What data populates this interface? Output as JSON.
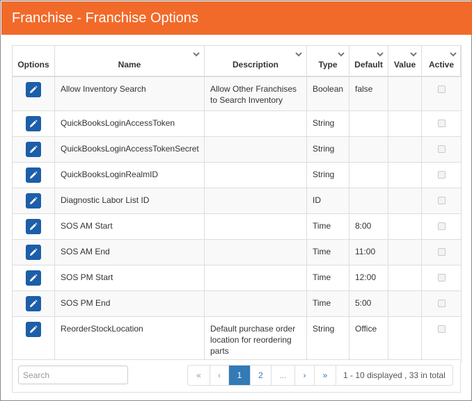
{
  "header": {
    "title": "Franchise - Franchise Options",
    "bg_color": "#f26a2a"
  },
  "table": {
    "columns": [
      {
        "key": "options",
        "label": "Options",
        "sortable": false
      },
      {
        "key": "name",
        "label": "Name",
        "sortable": true
      },
      {
        "key": "description",
        "label": "Description",
        "sortable": true
      },
      {
        "key": "type",
        "label": "Type",
        "sortable": true
      },
      {
        "key": "default",
        "label": "Default",
        "sortable": true
      },
      {
        "key": "value",
        "label": "Value",
        "sortable": true
      },
      {
        "key": "active",
        "label": "Active",
        "sortable": true
      }
    ],
    "rows": [
      {
        "name": "Allow Inventory Search",
        "description": "Allow Other Franchises to Search Inventory",
        "type": "Boolean",
        "default": "false",
        "value": "",
        "active": false
      },
      {
        "name": "QuickBooksLoginAccessToken",
        "description": "",
        "type": "String",
        "default": "",
        "value": "",
        "active": false
      },
      {
        "name": "QuickBooksLoginAccessTokenSecret",
        "description": "",
        "type": "String",
        "default": "",
        "value": "",
        "active": false
      },
      {
        "name": "QuickBooksLoginRealmID",
        "description": "",
        "type": "String",
        "default": "",
        "value": "",
        "active": false
      },
      {
        "name": "Diagnostic Labor List ID",
        "description": "",
        "type": "ID",
        "default": "",
        "value": "",
        "active": false
      },
      {
        "name": "SOS AM Start",
        "description": "",
        "type": "Time",
        "default": "8:00",
        "value": "",
        "active": false
      },
      {
        "name": "SOS AM End",
        "description": "",
        "type": "Time",
        "default": "11:00",
        "value": "",
        "active": false
      },
      {
        "name": "SOS PM Start",
        "description": "",
        "type": "Time",
        "default": "12:00",
        "value": "",
        "active": false
      },
      {
        "name": "SOS PM End",
        "description": "",
        "type": "Time",
        "default": "5:00",
        "value": "",
        "active": false
      },
      {
        "name": "ReorderStockLocation",
        "description": "Default purchase order location for reordering parts",
        "type": "String",
        "default": "Office",
        "value": "",
        "active": false
      }
    ],
    "edit_icon": "pencil-icon",
    "edit_button_color": "#1c5ea8"
  },
  "footer": {
    "search_placeholder": "Search",
    "search_value": "",
    "pager": {
      "first": "«",
      "prev": "‹",
      "pages": [
        "1",
        "2"
      ],
      "current_page": "1",
      "ellipsis": "...",
      "next": "›",
      "last": "»",
      "info": "1 - 10 displayed , 33 in total"
    },
    "accent_color": "#337ab7"
  }
}
